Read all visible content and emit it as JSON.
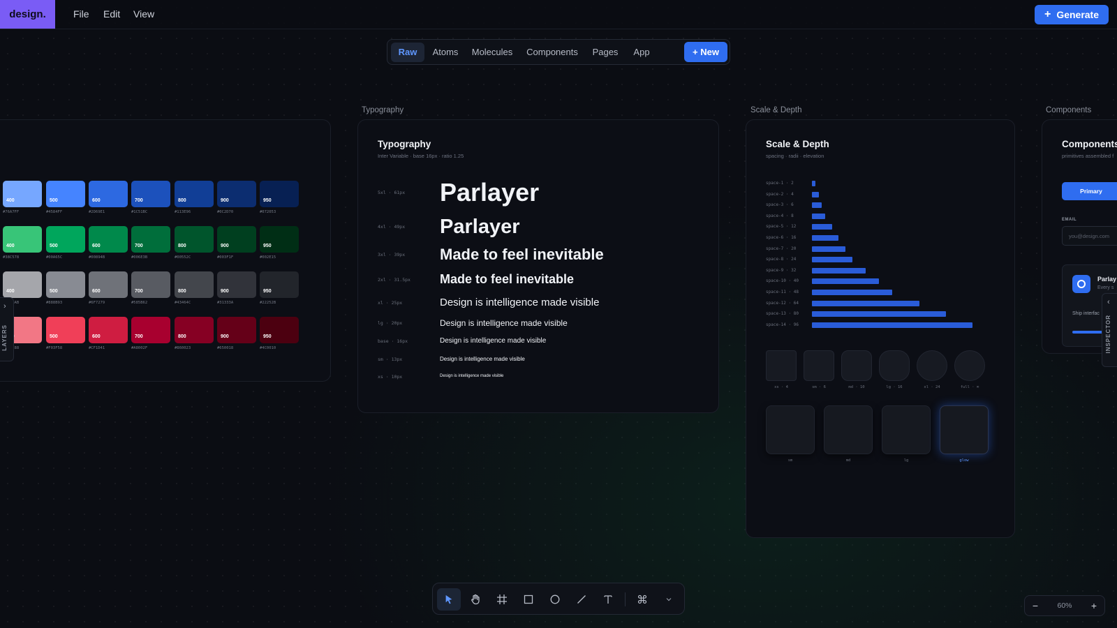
{
  "app": {
    "logo": "design."
  },
  "menu": [
    {
      "label": "File"
    },
    {
      "label": "Edit"
    },
    {
      "label": "View"
    }
  ],
  "generate_label": "Generate",
  "tabs": [
    {
      "label": "Raw",
      "active": true
    },
    {
      "label": "Atoms"
    },
    {
      "label": "Molecules"
    },
    {
      "label": "Components"
    },
    {
      "label": "Pages"
    },
    {
      "label": "App"
    }
  ],
  "new_label": "+ New",
  "frames": {
    "typography": "Typography",
    "scale": "Scale & Depth",
    "components": "Components"
  },
  "colors": {
    "rows": [
      {
        "swatches": [
          {
            "shade": "",
            "hex": "",
            "color": "#6b92e6"
          },
          {
            "shade": "400",
            "hex": "#76A7FF",
            "color": "#76a7ff"
          },
          {
            "shade": "500",
            "hex": "#4584FF",
            "color": "#4584ff"
          },
          {
            "shade": "600",
            "hex": "#2D69E1",
            "color": "#2d69e1"
          },
          {
            "shade": "700",
            "hex": "#1C51BC",
            "color": "#1c51bc"
          },
          {
            "shade": "800",
            "hex": "#113E96",
            "color": "#113e96"
          },
          {
            "shade": "900",
            "hex": "#0C2D70",
            "color": "#0c2d70"
          },
          {
            "shade": "950",
            "hex": "#072053",
            "color": "#072053"
          }
        ]
      },
      {
        "swatches": [
          {
            "shade": "",
            "hex": "",
            "color": "#3fb873"
          },
          {
            "shade": "400",
            "hex": "#38C578",
            "color": "#38c578"
          },
          {
            "shade": "500",
            "hex": "#00A65C",
            "color": "#00a65c"
          },
          {
            "shade": "600",
            "hex": "#00894B",
            "color": "#00894b"
          },
          {
            "shade": "700",
            "hex": "#006E3B",
            "color": "#006e3b"
          },
          {
            "shade": "800",
            "hex": "#00552C",
            "color": "#00552c"
          },
          {
            "shade": "900",
            "hex": "#003F1F",
            "color": "#003f1f"
          },
          {
            "shade": "950",
            "hex": "#002E15",
            "color": "#002e15"
          }
        ]
      },
      {
        "swatches": [
          {
            "shade": "",
            "hex": "",
            "color": "#a4a7ad"
          },
          {
            "shade": "400",
            "hex": "#A5A6AB",
            "color": "#a5a6ab"
          },
          {
            "shade": "500",
            "hex": "#888B93",
            "color": "#888b93"
          },
          {
            "shade": "600",
            "hex": "#6F7279",
            "color": "#6f7279"
          },
          {
            "shade": "700",
            "hex": "#585B62",
            "color": "#585b62"
          },
          {
            "shade": "800",
            "hex": "#43464C",
            "color": "#43464c"
          },
          {
            "shade": "900",
            "hex": "#31333A",
            "color": "#31333a"
          },
          {
            "shade": "950",
            "hex": "#22252B",
            "color": "#22252b"
          }
        ]
      },
      {
        "swatches": [
          {
            "shade": "",
            "hex": "",
            "color": "#ec7a84"
          },
          {
            "shade": "400",
            "hex": "#FF7788",
            "color": "#f27785"
          },
          {
            "shade": "500",
            "hex": "#F03F58",
            "color": "#f03f58"
          },
          {
            "shade": "600",
            "hex": "#CF1D41",
            "color": "#cf1d41"
          },
          {
            "shade": "700",
            "hex": "#A8002F",
            "color": "#a8002f"
          },
          {
            "shade": "800",
            "hex": "#860023",
            "color": "#860023"
          },
          {
            "shade": "900",
            "hex": "#650018",
            "color": "#650018"
          },
          {
            "shade": "950",
            "hex": "#4C0010",
            "color": "#4c0010"
          }
        ]
      }
    ]
  },
  "typography": {
    "title": "Typography",
    "subtitle": "Inter Variable · base 16px · ratio 1.25",
    "rows": [
      {
        "size": "5xl · 61px",
        "sample": "Parlayer",
        "font_px": 36,
        "weight": "bold"
      },
      {
        "size": "4xl · 49px",
        "sample": "Parlayer",
        "font_px": 29,
        "weight": "bold"
      },
      {
        "size": "3xl · 39px",
        "sample": "Made to feel inevitable",
        "font_px": 22,
        "weight": "bold"
      },
      {
        "size": "2xl · 31.5px",
        "sample": "Made to feel inevitable",
        "font_px": 18,
        "weight": "bold"
      },
      {
        "size": "xl · 25px",
        "sample": "Design is intelligence made visible",
        "font_px": 15,
        "weight": "normal"
      },
      {
        "size": "lg · 20px",
        "sample": "Design is intelligence made visible",
        "font_px": 12,
        "weight": "normal"
      },
      {
        "size": "base · 16px",
        "sample": "Design is intelligence made visible",
        "font_px": 10,
        "weight": "normal"
      },
      {
        "size": "sm · 13px",
        "sample": "Design is intelligence made visible",
        "font_px": 8,
        "weight": "normal"
      },
      {
        "size": "xs · 10px",
        "sample": "Design is intelligence made visible",
        "font_px": 6,
        "weight": "normal"
      }
    ]
  },
  "scale": {
    "title": "Scale & Depth",
    "subtitle": "spacing · radii · elevation",
    "spacing": [
      {
        "label": "space-1 · 2",
        "value": 2
      },
      {
        "label": "space-2 · 4",
        "value": 4
      },
      {
        "label": "space-3 · 6",
        "value": 6
      },
      {
        "label": "space-4 · 8",
        "value": 8
      },
      {
        "label": "space-5 · 12",
        "value": 12
      },
      {
        "label": "space-6 · 16",
        "value": 16
      },
      {
        "label": "space-7 · 20",
        "value": 20
      },
      {
        "label": "space-8 · 24",
        "value": 24
      },
      {
        "label": "space-9 · 32",
        "value": 32
      },
      {
        "label": "space-10 · 40",
        "value": 40
      },
      {
        "label": "space-11 · 48",
        "value": 48
      },
      {
        "label": "space-12 · 64",
        "value": 64
      },
      {
        "label": "space-13 · 80",
        "value": 80
      },
      {
        "label": "space-14 · 96",
        "value": 96
      }
    ],
    "radii": [
      {
        "label": "xs · 4",
        "radius": 4
      },
      {
        "label": "sm · 6",
        "radius": 6
      },
      {
        "label": "md · 10",
        "radius": 10
      },
      {
        "label": "lg · 16",
        "radius": 16
      },
      {
        "label": "xl · 24",
        "radius": 24
      },
      {
        "label": "full · ∞",
        "radius": 999
      }
    ],
    "shadows": [
      {
        "label": "sm",
        "glow": false
      },
      {
        "label": "md",
        "glow": false
      },
      {
        "label": "lg",
        "glow": false
      },
      {
        "label": "glow",
        "glow": true
      }
    ]
  },
  "components": {
    "title": "Components",
    "subtitle": "primitives assembled f",
    "primary_label": "Primary",
    "email_label": "EMAIL",
    "email_placeholder": "you@design.com",
    "card_title": "Parlay",
    "card_sub": "Every s",
    "card_text": "Ship interfac"
  },
  "side": {
    "layers": "LAYERS",
    "inspector": "INSPECTOR"
  },
  "toolbar": [
    {
      "icon": "cursor-icon",
      "active": true
    },
    {
      "icon": "hand-icon"
    },
    {
      "icon": "frame-icon"
    },
    {
      "icon": "rectangle-icon"
    },
    {
      "icon": "ellipse-icon"
    },
    {
      "icon": "line-icon"
    },
    {
      "icon": "text-icon"
    },
    {
      "icon": "command-icon"
    },
    {
      "icon": "chevron-down-icon"
    }
  ],
  "zoom": {
    "minus": "−",
    "value": "60%",
    "plus": "+"
  },
  "accent": "#2f6df0",
  "brand": "#7a5cf5"
}
